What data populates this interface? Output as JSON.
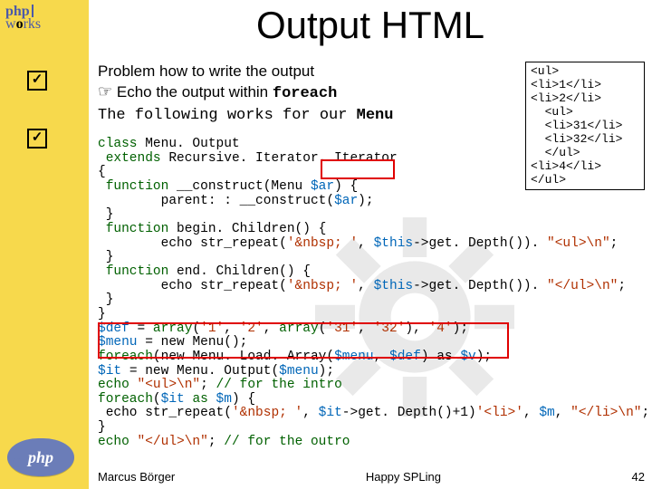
{
  "brand": {
    "php": "php",
    "works_w": "w",
    "works_o": "o",
    "works_rks": "rks",
    "bottom_label": "php"
  },
  "title": "Output HTML",
  "bodytext": {
    "line1": "Problem how to write the output",
    "line2_icon": "☞",
    "line2": " Echo the output within ",
    "line2_mono": "foreach",
    "line3a": "The following works for our ",
    "line3_mono": "Menu"
  },
  "code": {
    "l1a": "class ",
    "l1b": "Menu. Output",
    "l2a": " extends ",
    "l2b": "Recursive. Iterator. Iterator",
    "l3": "{",
    "l4a": " function ",
    "l4b": "__construct",
    "l4c": "(Menu ",
    "l4d": "$ar",
    "l4e": ") {",
    "l5a": "        parent",
    "l5b": ": : __construct(",
    "l5c": "$ar",
    "l5d": ");",
    "l6": " }",
    "l7a": " function ",
    "l7b": "begin. Children",
    "l7c": "() {",
    "l8a": "        echo str_repeat",
    "l8b": "(",
    "l8c": "'&nbsp; '",
    "l8d": ", ",
    "l8e": "$this",
    "l8f": "->",
    "l8g": "get. Depth",
    "l8h": "()). ",
    "l8i": "\"<ul>\\n\"",
    "l8j": ";",
    "l9": " }",
    "l10a": " function ",
    "l10b": "end. Children",
    "l10c": "() {",
    "l11a": "        echo str_repeat",
    "l11b": "(",
    "l11c": "'&nbsp; '",
    "l11d": ", ",
    "l11e": "$this",
    "l11f": "->",
    "l11g": "get. Depth",
    "l11h": "()). ",
    "l11i": "\"</ul>\\n\"",
    "l11j": ";",
    "l12": " }",
    "l13": "}",
    "l14a": "$def ",
    "l14b": "= ",
    "l14c": "array",
    "l14d": "(",
    "l14e": "'1'",
    "l14f": ", ",
    "l14g": "'2'",
    "l14h": ", ",
    "l14i": "array",
    "l14j": "(",
    "l14k": "'31'",
    "l14l": ", ",
    "l14m": "'32'",
    "l14n": "), ",
    "l14o": "'4'",
    "l14p": ");",
    "l15a": "$menu ",
    "l15b": "= new ",
    "l15c": "Menu",
    "l15d": "();",
    "l16a": "foreach",
    "l16b": "(new ",
    "l16c": "Menu. Load. Array",
    "l16d": "(",
    "l16e": "$menu",
    "l16f": ", ",
    "l16g": "$def",
    "l16h": ") as ",
    "l16i": "$v",
    "l16j": ");",
    "l17a": "$it ",
    "l17b": "= new ",
    "l17c": "Menu. Output",
    "l17d": "(",
    "l17e": "$menu",
    "l17f": ");",
    "l18a": "echo ",
    "l18b": "\"<ul>\\n\"",
    "l18c": "; ",
    "l18d": "// for the intro",
    "l19a": "foreach",
    "l19b": "(",
    "l19c": "$it ",
    "l19d": "as ",
    "l19e": "$m",
    "l19f": ") {",
    "l20a": " echo str_repeat",
    "l20b": "(",
    "l20c": "'&nbsp; '",
    "l20d": ", ",
    "l20e": "$it",
    "l20f": "->",
    "l20g": "get. Depth",
    "l20h": "()",
    "l20i": "+1",
    "l20j": ")",
    "l20k": "'<li>'",
    "l20l": ", ",
    "l20m": "$m",
    "l20n": ", ",
    "l20o": "\"</li>\\n\"",
    "l20p": ";",
    "l21": "}",
    "l22a": "echo ",
    "l22b": "\"</ul>\\n\"",
    "l22c": "; ",
    "l22d": "// for the outro"
  },
  "output": "<ul>\n<li>1</li>\n<li>2</li>\n  <ul>\n  <li>31</li>\n  <li>32</li>\n  </ul>\n<li>4</li>\n</ul>",
  "footer": {
    "author": "Marcus Börger",
    "subject": "Happy SPLing",
    "page": "42"
  }
}
